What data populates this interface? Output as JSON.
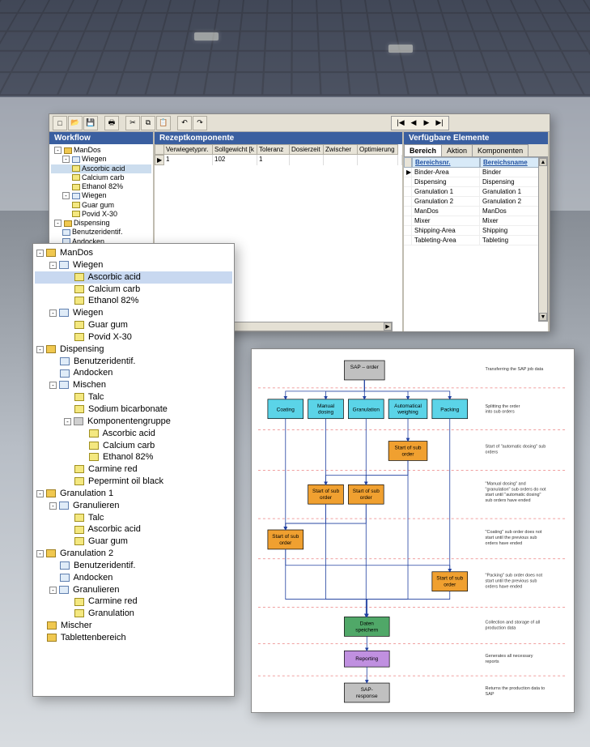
{
  "app": {
    "toolbar_buttons": [
      "new",
      "open",
      "save",
      "",
      "print",
      "",
      "cut",
      "copy",
      "paste",
      "",
      "undo",
      "redo",
      "",
      "help"
    ],
    "nav": {
      "first": "|◀",
      "prev": "◀",
      "next": "▶",
      "last": "▶|"
    }
  },
  "panes": {
    "workflow_title": "Workflow",
    "rezept_title": "Rezeptkomponente",
    "verfuegbar_title": "Verfügbare Elemente"
  },
  "mini_tree": [
    {
      "lv": 0,
      "exp": "-",
      "ico": "folder",
      "t": "ManDos"
    },
    {
      "lv": 1,
      "exp": "-",
      "ico": "doc",
      "t": "Wiegen"
    },
    {
      "lv": 2,
      "ico": "comp",
      "t": "Ascorbic acid",
      "sel": true
    },
    {
      "lv": 2,
      "ico": "comp",
      "t": "Calcium carb"
    },
    {
      "lv": 2,
      "ico": "comp",
      "t": "Ethanol 82%"
    },
    {
      "lv": 1,
      "exp": "-",
      "ico": "doc",
      "t": "Wiegen"
    },
    {
      "lv": 2,
      "ico": "comp",
      "t": "Guar gum"
    },
    {
      "lv": 2,
      "ico": "comp",
      "t": "Povid X-30"
    },
    {
      "lv": 0,
      "exp": "-",
      "ico": "folder",
      "t": "Dispensing"
    },
    {
      "lv": 1,
      "ico": "doc",
      "t": "Benutzeridentif."
    },
    {
      "lv": 1,
      "ico": "doc",
      "t": "Andocken"
    }
  ],
  "grid": {
    "cols": [
      "",
      "Verwiegetypnr.",
      "Sollgewicht [k",
      "Toleranz",
      "Dosierzeit",
      "Zwischer",
      "Optimierung"
    ],
    "row": [
      "▶",
      "1",
      "102",
      "1",
      "",
      "",
      "",
      ""
    ]
  },
  "right": {
    "tabs": [
      "Bereich",
      "Aktion",
      "Komponenten"
    ],
    "head": [
      "Bereichsnr.",
      "Bereichsname"
    ],
    "rows": [
      [
        "Binder-Area",
        "Binder"
      ],
      [
        "Dispensing",
        "Dispensing"
      ],
      [
        "Granulation 1",
        "Granulation 1"
      ],
      [
        "Granulation 2",
        "Granulation 2"
      ],
      [
        "ManDos",
        "ManDos"
      ],
      [
        "Mixer",
        "Mixer"
      ],
      [
        "Shipping-Area",
        "Shipping"
      ],
      [
        "Tableting-Area",
        "Tableting"
      ]
    ]
  },
  "big_tree": [
    {
      "lv": 0,
      "exp": "-",
      "ico": "folder",
      "t": "ManDos"
    },
    {
      "lv": 1,
      "exp": "-",
      "ico": "doc",
      "t": "Wiegen"
    },
    {
      "lv": 2,
      "ico": "comp",
      "t": "Ascorbic acid",
      "sel": true
    },
    {
      "lv": 2,
      "ico": "comp",
      "t": "Calcium carb"
    },
    {
      "lv": 2,
      "ico": "comp",
      "t": "Ethanol 82%"
    },
    {
      "lv": 1,
      "exp": "-",
      "ico": "doc",
      "t": "Wiegen"
    },
    {
      "lv": 2,
      "ico": "comp",
      "t": "Guar gum"
    },
    {
      "lv": 2,
      "ico": "comp",
      "t": "Povid X-30"
    },
    {
      "lv": 0,
      "exp": "-",
      "ico": "folder",
      "t": "Dispensing"
    },
    {
      "lv": 1,
      "ico": "doc",
      "t": "Benutzeridentif."
    },
    {
      "lv": 1,
      "ico": "doc",
      "t": "Andocken"
    },
    {
      "lv": 1,
      "exp": "-",
      "ico": "doc",
      "t": "Mischen"
    },
    {
      "lv": 2,
      "ico": "comp",
      "t": "Talc"
    },
    {
      "lv": 2,
      "ico": "comp",
      "t": "Sodium bicarbonate"
    },
    {
      "lv": 2,
      "exp": "-",
      "ico": "grp",
      "t": "Komponentengruppe"
    },
    {
      "lv": 3,
      "ico": "comp",
      "t": "Ascorbic acid"
    },
    {
      "lv": 3,
      "ico": "comp",
      "t": "Calcium carb"
    },
    {
      "lv": 3,
      "ico": "comp",
      "t": "Ethanol 82%"
    },
    {
      "lv": 2,
      "ico": "comp",
      "t": "Carmine red"
    },
    {
      "lv": 2,
      "ico": "comp",
      "t": "Pepermint oil black"
    },
    {
      "lv": 0,
      "exp": "-",
      "ico": "folder",
      "t": "Granulation 1"
    },
    {
      "lv": 1,
      "exp": "-",
      "ico": "doc",
      "t": "Granulieren"
    },
    {
      "lv": 2,
      "ico": "comp",
      "t": "Talc"
    },
    {
      "lv": 2,
      "ico": "comp",
      "t": "Ascorbic acid"
    },
    {
      "lv": 2,
      "ico": "comp",
      "t": "Guar gum"
    },
    {
      "lv": 0,
      "exp": "-",
      "ico": "folder",
      "t": "Granulation 2"
    },
    {
      "lv": 1,
      "ico": "doc",
      "t": "Benutzeridentif."
    },
    {
      "lv": 1,
      "ico": "doc",
      "t": "Andocken"
    },
    {
      "lv": 1,
      "exp": "-",
      "ico": "doc",
      "t": "Granulieren"
    },
    {
      "lv": 2,
      "ico": "comp",
      "t": "Carmine red"
    },
    {
      "lv": 2,
      "ico": "comp",
      "t": "Granulation"
    },
    {
      "lv": 0,
      "ico": "folder",
      "t": "Mischer"
    },
    {
      "lv": 0,
      "ico": "folder",
      "t": "Tablettenbereich"
    }
  ],
  "flow": {
    "sap_order": "SAP – order",
    "coating": "Coating",
    "manual": "Manual dosing",
    "gran": "Granulation",
    "auto": "Automatical weighing",
    "packing": "Packing",
    "start": "Start of sub order",
    "daten": "Daten speichern",
    "reporting": "Reporting",
    "sap_resp": "SAP-response",
    "notes": [
      "Transferring the SAP job data",
      "Splitting the order into sub orders",
      "Start of \"automatic dosing\" sub orders",
      "\"Manual dosing\" and \"granulation\" sub orders do not start until \"automatic dosing\" sub orders have ended",
      "\"Coating\" sub order does not start until the previous sub orders have ended",
      "\"Packing\" sub order does not start until the previous sub orders have ended",
      "Collection and storage of all production data",
      "Generates all necessary reports",
      "Returns the production data to SAP"
    ]
  }
}
